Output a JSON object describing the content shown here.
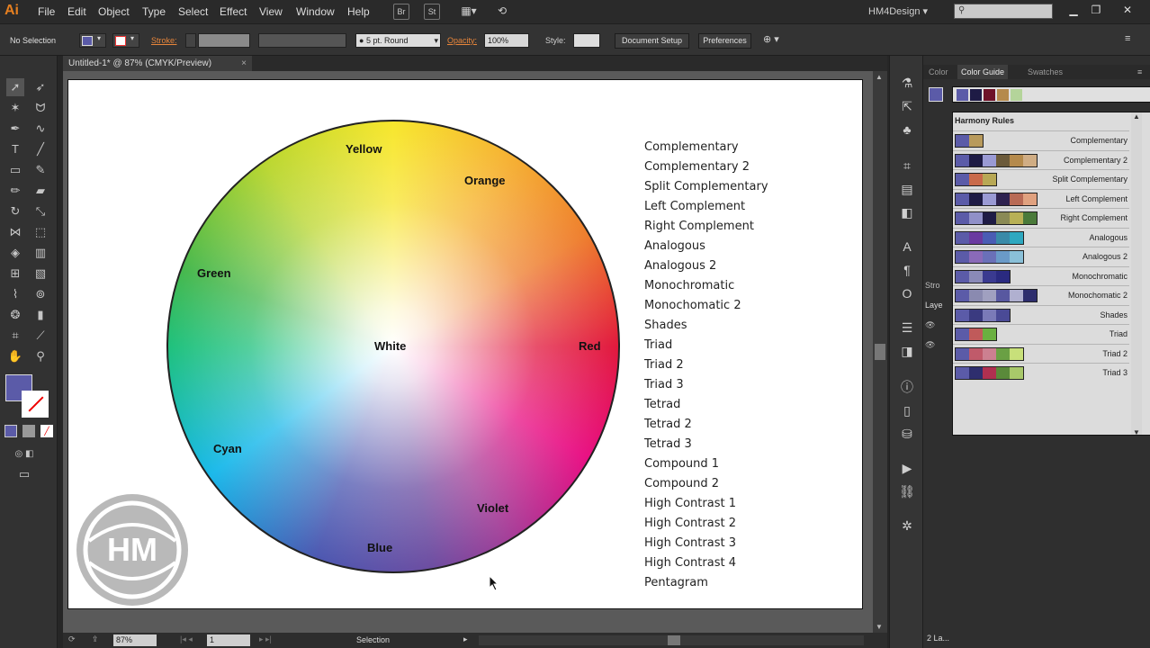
{
  "menubar": {
    "logo": "Ai",
    "items": [
      "File",
      "Edit",
      "Object",
      "Type",
      "Select",
      "Effect",
      "View",
      "Window",
      "Help"
    ],
    "bridge_btn": "Br",
    "stock_btn": "St",
    "workspace": "HM4Design"
  },
  "controlbar": {
    "selection": "No Selection",
    "stroke_label": "Stroke:",
    "brush": "5 pt. Round",
    "opacity_label": "Opacity:",
    "opacity_value": "100%",
    "style_label": "Style:",
    "doc_setup": "Document Setup",
    "preferences": "Preferences"
  },
  "doc": {
    "tab_title": "Untitled-1* @ 87% (CMYK/Preview)",
    "close": "×"
  },
  "artboard": {
    "wheel_labels": {
      "yellow": "Yellow",
      "orange": "Orange",
      "red": "Red",
      "violet": "Violet",
      "blue": "Blue",
      "cyan": "Cyan",
      "green": "Green",
      "white": "White"
    },
    "harmonies": [
      "Complementary",
      "Complementary 2",
      "Split Complementary",
      "Left Complement",
      "Right Complement",
      "Analogous",
      "Analogous 2",
      "Monochromatic",
      "Monochomatic 2",
      "Shades",
      "Triad",
      "Triad 2",
      "Triad 3",
      "Tetrad",
      "Tetrad 2",
      "Tetrad 3",
      "Compound 1",
      "Compound 2",
      "High Contrast 1",
      "High Contrast 2",
      "High Contrast 3",
      "High Contrast 4",
      "Pentagram"
    ],
    "logo_text": "HM"
  },
  "statusbar": {
    "zoom": "87%",
    "artboard_num": "1",
    "mode": "Selection"
  },
  "rightpanel": {
    "tabs": [
      "Color",
      "Color Guide",
      "Swatches"
    ],
    "popup_title": "Harmony Rules",
    "guide_colors": [
      "#5b5ba8",
      "#1e1b45",
      "#6e1228",
      "#b58a4c",
      "#b4d49a"
    ],
    "rules": [
      {
        "name": "Complementary",
        "colors": [
          "#5b5ba8",
          "#b89a5c"
        ]
      },
      {
        "name": "Complementary 2",
        "colors": [
          "#5b5ba8",
          "#1e1b45",
          "#9a9ad4",
          "#6b5a3a",
          "#b58a4c",
          "#d0ad84"
        ]
      },
      {
        "name": "Split Complementary",
        "colors": [
          "#5b5ba8",
          "#c96a4a",
          "#b8a855"
        ]
      },
      {
        "name": "Left Complement",
        "colors": [
          "#5b5ba8",
          "#1e1b45",
          "#9a9ad4",
          "#2e2250",
          "#b86a55",
          "#e0a17f"
        ]
      },
      {
        "name": "Right Complement",
        "colors": [
          "#5b5ba8",
          "#9090c8",
          "#1e1b45",
          "#8a8a55",
          "#b8b055",
          "#4a7a3a"
        ]
      },
      {
        "name": "Analogous",
        "colors": [
          "#5b5ba8",
          "#6a3aa0",
          "#4a5cb4",
          "#3a8aa8",
          "#2ea8c0"
        ]
      },
      {
        "name": "Analogous 2",
        "colors": [
          "#5b5ba8",
          "#8a6ab8",
          "#6a70b8",
          "#6a9ac8",
          "#8ac0d8"
        ]
      },
      {
        "name": "Monochromatic",
        "colors": [
          "#5b5ba8",
          "#8a8ab8",
          "#3a3a90",
          "#2a2a80"
        ]
      },
      {
        "name": "Monochomatic 2",
        "colors": [
          "#5b5ba8",
          "#8a8ab0",
          "#a0a0c0",
          "#5858a0",
          "#b0b0d0",
          "#2e2e6e"
        ]
      },
      {
        "name": "Shades",
        "colors": [
          "#5b5ba8",
          "#3a3a80",
          "#7a7ab8",
          "#4a4a96"
        ]
      },
      {
        "name": "Triad",
        "colors": [
          "#5b5ba8",
          "#c05a5a",
          "#6ab040"
        ]
      },
      {
        "name": "Triad 2",
        "colors": [
          "#5b5ba8",
          "#c05a6a",
          "#cc8090",
          "#6aa044",
          "#c8e07a"
        ]
      },
      {
        "name": "Triad 3",
        "colors": [
          "#5b5ba8",
          "#2e2e6e",
          "#b03050",
          "#5a8a3a",
          "#a8c86a"
        ]
      }
    ],
    "layers_count": "2 La..."
  }
}
